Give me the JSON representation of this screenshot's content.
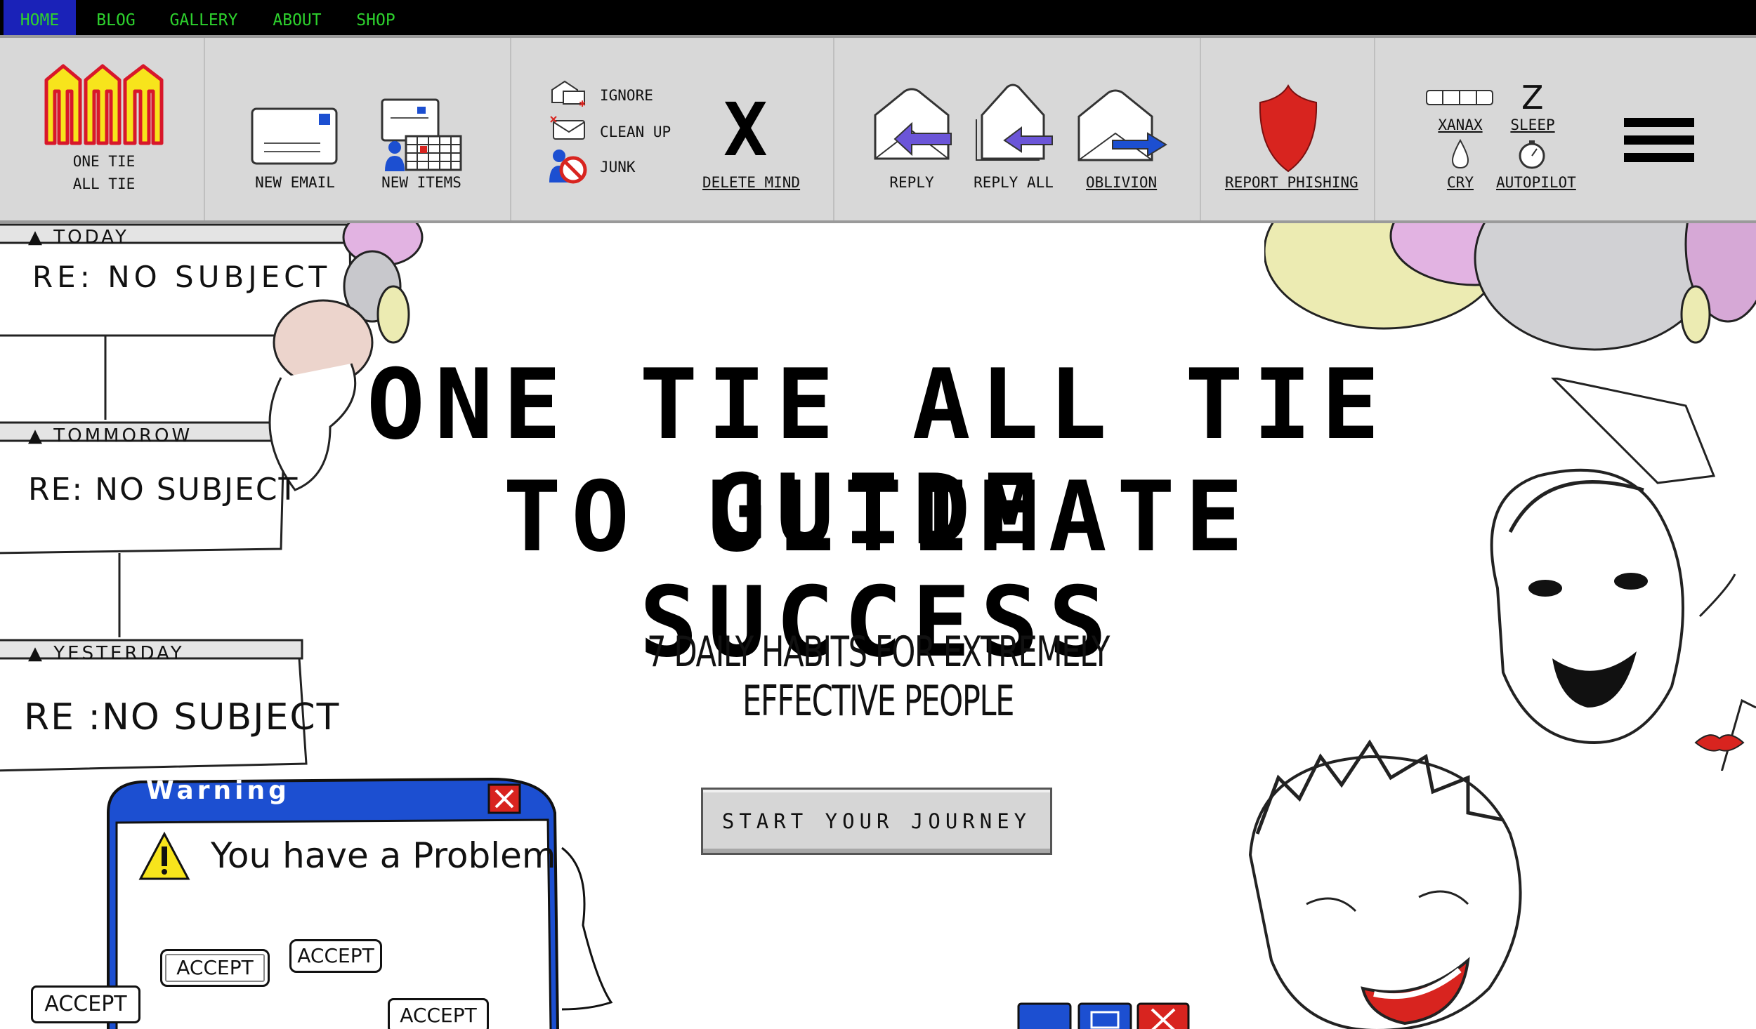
{
  "nav": {
    "items": [
      "HOME",
      "BLOG",
      "GALLERY",
      "ABOUT",
      "SHOP"
    ],
    "active": "HOME"
  },
  "ribbon": {
    "logo_line1": "ONE TIE",
    "logo_line2": "ALL TIE",
    "new_email": "NEW EMAIL",
    "new_items": "NEW ITEMS",
    "ignore": "IGNORE",
    "clean_up": "CLEAN UP",
    "junk": "JUNK",
    "delete_mind": "DELETE MIND",
    "reply": "REPLY",
    "reply_all": "REPLY ALL",
    "oblivion": "OBLIVION",
    "report_phishing": "REPORT PHISHING",
    "xanax": "XANAX",
    "sleep": "SLEEP",
    "cry": "CRY",
    "autopilot": "AUTOPILOT",
    "sleep_glyph": "Z",
    "delete_glyph": "X"
  },
  "hero": {
    "title_line1": "ONE TIE ALL TIE GUIDE",
    "title_line2": "TO ULTIMATE SUCCESS",
    "subtitle": "7 DAILY HABITS FOR EXTREMELY EFFECTIVE PEOPLE",
    "cta": "START YOUR JOURNEY"
  },
  "emails": {
    "today_label": "TODAY",
    "tomorrow_label": "TOMMOROW",
    "yesterday_label": "YESTERDAY",
    "subject1": "RE: NO SUBJECT",
    "subject2": "RE: NO SUBJECT",
    "subject3": "RE :NO SUBJECT"
  },
  "warning": {
    "title": "Warning",
    "message": "You have a Problem",
    "accept1": "ACCEPT",
    "accept2": "ACCEPT",
    "accept3": "ACCEPT",
    "accept4": "ACCEPT"
  },
  "colors": {
    "nav_bg": "#000000",
    "nav_text": "#2dd12d",
    "nav_active": "#1a22b8",
    "ribbon_bg": "#d8d8d8",
    "logo_yellow": "#f7e41c",
    "logo_red": "#d8172a",
    "phishing_red": "#d8241f",
    "warning_blue": "#1c4fd1"
  }
}
